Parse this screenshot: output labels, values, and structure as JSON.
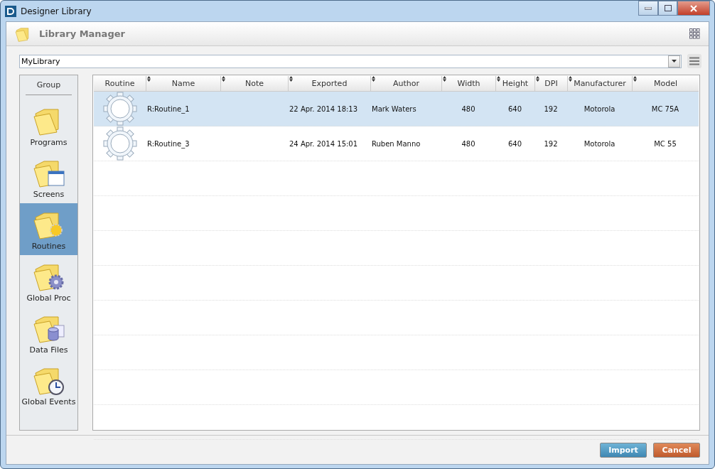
{
  "window": {
    "title": "Designer Library"
  },
  "header": {
    "title": "Library Manager"
  },
  "library_select": {
    "value": "MyLibrary"
  },
  "sidebar": {
    "heading": "Group",
    "items": [
      {
        "label": "Programs",
        "kind": "plain",
        "selected": false
      },
      {
        "label": "Screens",
        "kind": "window",
        "selected": false
      },
      {
        "label": "Routines",
        "kind": "sun",
        "selected": true
      },
      {
        "label": "Global Proc",
        "kind": "gear",
        "selected": false
      },
      {
        "label": "Data Files",
        "kind": "database",
        "selected": false
      },
      {
        "label": "Global Events",
        "kind": "clock",
        "selected": false
      }
    ]
  },
  "table": {
    "columns": [
      {
        "label": "Routine",
        "sortable": false
      },
      {
        "label": "Name",
        "sortable": true
      },
      {
        "label": "Note",
        "sortable": true
      },
      {
        "label": "Exported",
        "sortable": true
      },
      {
        "label": "Author",
        "sortable": true
      },
      {
        "label": "Width",
        "sortable": true
      },
      {
        "label": "Height",
        "sortable": true
      },
      {
        "label": "DPI",
        "sortable": true
      },
      {
        "label": "Manufacturer",
        "sortable": true
      },
      {
        "label": "Model",
        "sortable": true
      }
    ],
    "rows": [
      {
        "selected": true,
        "cells": [
          "",
          "R:Routine_1",
          "",
          "22 Apr. 2014 18:13",
          "Mark Waters",
          "480",
          "640",
          "192",
          "Motorola",
          "MC 75A"
        ]
      },
      {
        "selected": false,
        "cells": [
          "",
          "R:Routine_3",
          "",
          "24 Apr. 2014 15:01",
          "Ruben Manno",
          "480",
          "640",
          "192",
          "Motorola",
          "MC 55"
        ]
      }
    ]
  },
  "buttons": [
    {
      "label": "Import",
      "kind": "primary"
    },
    {
      "label": "Cancel",
      "kind": "danger"
    }
  ]
}
